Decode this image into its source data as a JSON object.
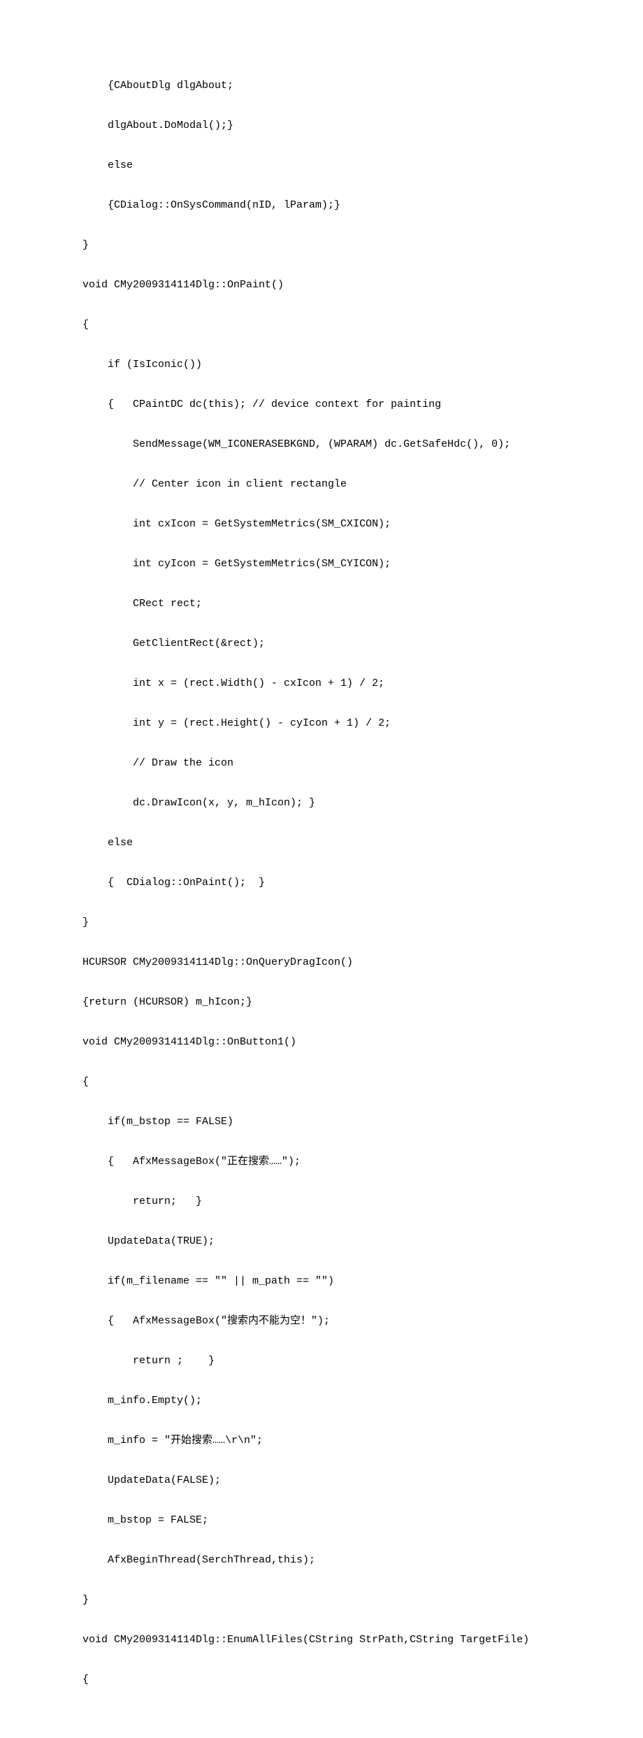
{
  "lines": [
    "    {CAboutDlg dlgAbout;",
    "    dlgAbout.DoModal();}",
    "    else",
    "    {CDialog::OnSysCommand(nID, lParam);}",
    "}",
    "void CMy2009314114Dlg::OnPaint() ",
    "{",
    "    if (IsIconic())",
    "    {   CPaintDC dc(this); // device context for painting",
    "        SendMessage(WM_ICONERASEBKGND, (WPARAM) dc.GetSafeHdc(), 0);",
    "        // Center icon in client rectangle",
    "        int cxIcon = GetSystemMetrics(SM_CXICON);",
    "        int cyIcon = GetSystemMetrics(SM_CYICON);",
    "        CRect rect;",
    "        GetClientRect(&rect);",
    "        int x = (rect.Width() - cxIcon + 1) / 2;",
    "        int y = (rect.Height() - cyIcon + 1) / 2;",
    "        // Draw the icon",
    "        dc.DrawIcon(x, y, m_hIcon); }",
    "    else",
    "    {  CDialog::OnPaint();  }",
    "}",
    "HCURSOR CMy2009314114Dlg::OnQueryDragIcon()",
    "{return (HCURSOR) m_hIcon;}",
    "void CMy2009314114Dlg::OnButton1() ",
    "{",
    "    if(m_bstop == FALSE)",
    "    {   AfxMessageBox(\"正在搜索……\");",
    "        return;   }",
    "    UpdateData(TRUE);",
    "    if(m_filename == \"\" || m_path == \"\")",
    "    {   AfxMessageBox(\"搜索内不能为空！\");",
    "        return ;    }",
    "    m_info.Empty();",
    "    m_info = \"开始搜索……\\r\\n\";",
    "    UpdateData(FALSE);",
    "    m_bstop = FALSE;",
    "    AfxBeginThread(SerchThread,this);",
    "}",
    "void CMy2009314114Dlg::EnumAllFiles(CString StrPath,CString TargetFile)",
    "{"
  ]
}
